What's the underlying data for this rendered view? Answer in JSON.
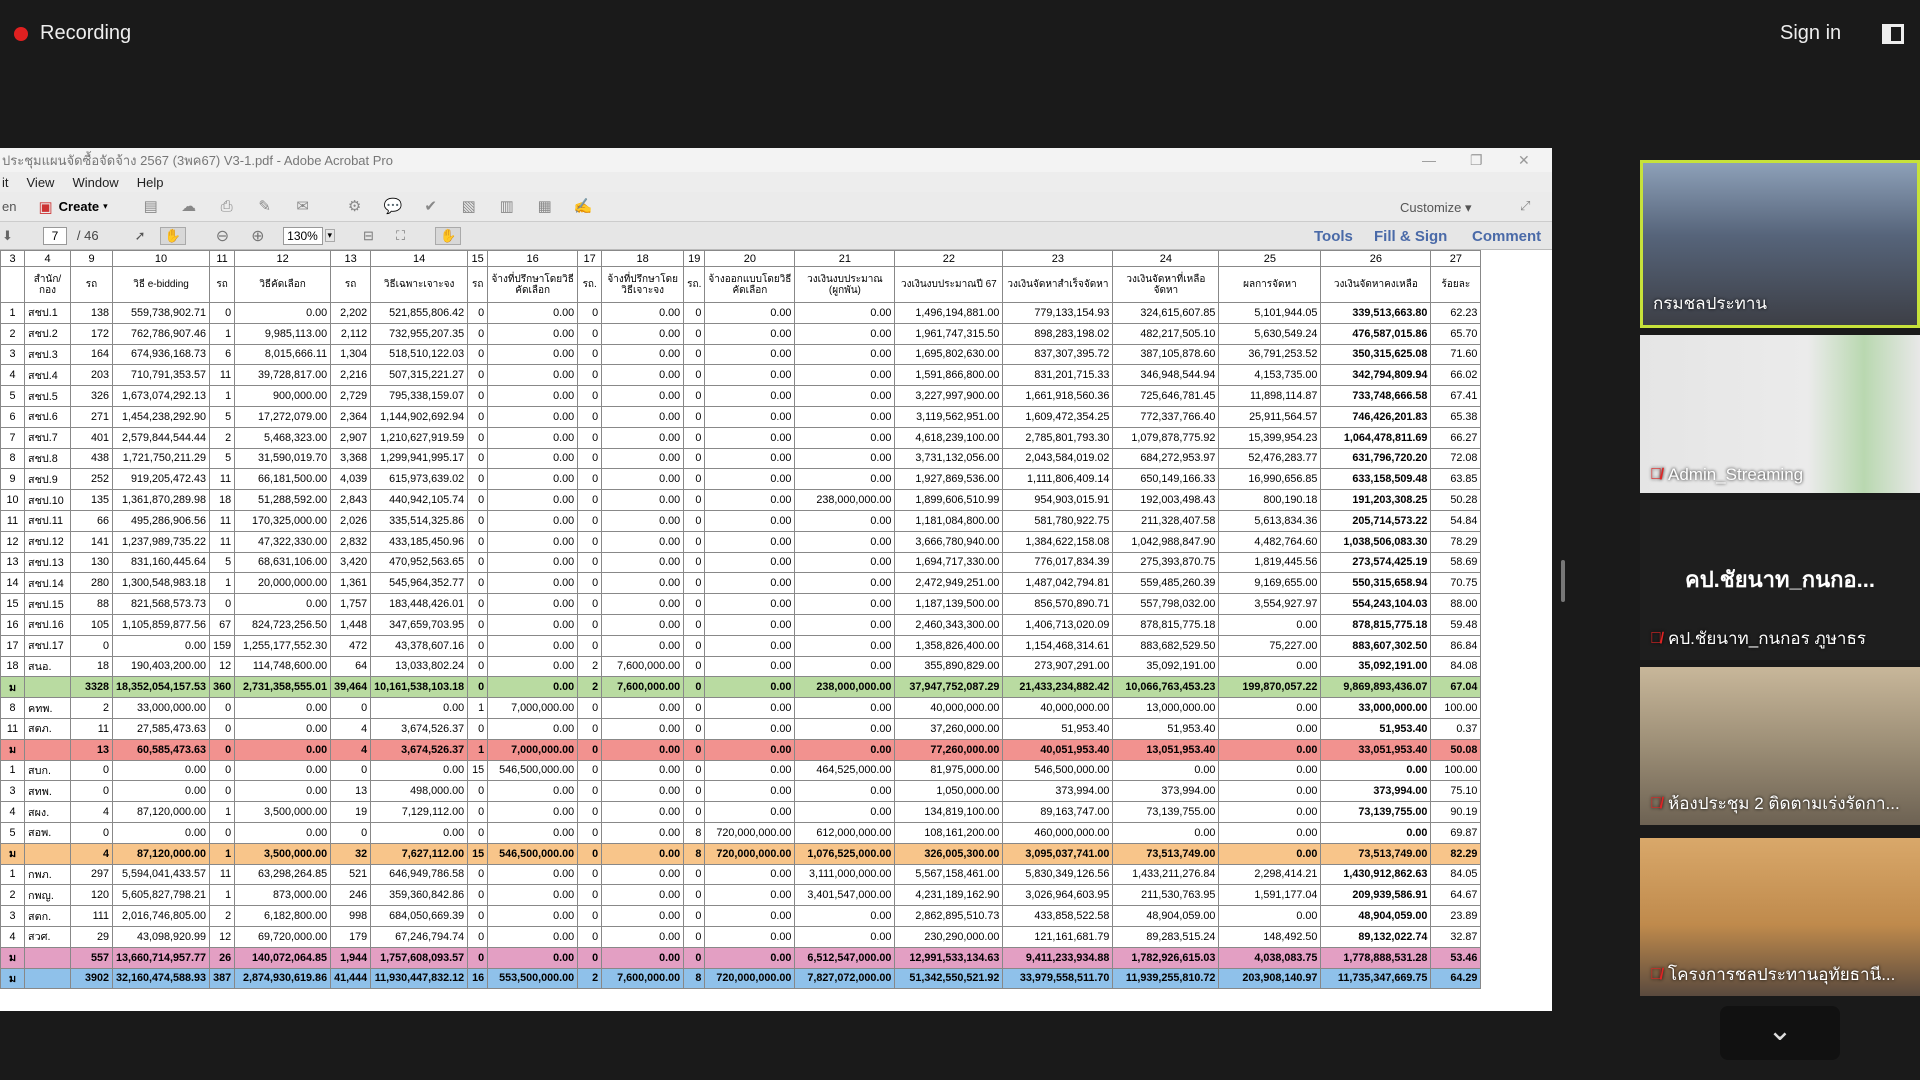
{
  "recording": {
    "label": "Recording"
  },
  "signin": "Sign in",
  "acrobat": {
    "title": "ประชุมแผนจัดซื้อจัดจ้าง 2567 (3พค67) V3-1.pdf - Adobe Acrobat Pro",
    "menus": [
      "it",
      "View",
      "Window",
      "Help"
    ],
    "create": "Create",
    "customize": "Customize",
    "page_current": "7",
    "page_total": "/ 46",
    "zoom": "130%",
    "tabs": [
      "Tools",
      "Fill & Sign",
      "Comment"
    ]
  },
  "table": {
    "colnums": [
      "3",
      "4",
      "9",
      "10",
      "11",
      "12",
      "13",
      "14",
      "15",
      "16",
      "17",
      "18",
      "19",
      "20",
      "21",
      "22",
      "23",
      "24",
      "25",
      "26",
      "27"
    ],
    "headers": [
      "",
      "สำนัก/กอง",
      "รถ",
      "วิธี e-bidding",
      "รถ",
      "วิธีคัดเลือก",
      "รถ",
      "วิธีเฉพาะเจาะจง",
      "รถ",
      "จ้างที่ปรึกษาโดยวิธีคัดเลือก",
      "รถ.",
      "จ้างที่ปรึกษาโดยวิธีเจาะจง",
      "รถ.",
      "จ้างออกแบบโดยวิธีคัดเลือก",
      "วงเงินงบประมาณ (ผูกพัน)",
      "วงเงินงบประมาณปี 67",
      "วงเงินจัดหาสำเร็จจัดหา",
      "วงเงินจัดหาที่เหลือจัดหา",
      "ผลการจัดหา",
      "วงเงินจัดหาคงเหลือ",
      "ร้อยละ"
    ],
    "rows": [
      {
        "c": [
          "1",
          "สชป.1",
          "138",
          "559,738,902.71",
          "0",
          "0.00",
          "2,202",
          "521,855,806.42",
          "0",
          "0.00",
          "0",
          "0.00",
          "0",
          "0.00",
          "0.00",
          "1,496,194,881.00",
          "779,133,154.93",
          "324,615,607.85",
          "5,101,944.05",
          "339,513,663.80",
          "62.23"
        ],
        "s": ""
      },
      {
        "c": [
          "2",
          "สชป.2",
          "172",
          "762,786,907.46",
          "1",
          "9,985,113.00",
          "2,112",
          "732,955,207.35",
          "0",
          "0.00",
          "0",
          "0.00",
          "0",
          "0.00",
          "0.00",
          "1,961,747,315.50",
          "898,283,198.02",
          "482,217,505.10",
          "5,630,549.24",
          "476,587,015.86",
          "65.70"
        ],
        "s": ""
      },
      {
        "c": [
          "3",
          "สชป.3",
          "164",
          "674,936,168.73",
          "6",
          "8,015,666.11",
          "1,304",
          "518,510,122.03",
          "0",
          "0.00",
          "0",
          "0.00",
          "0",
          "0.00",
          "0.00",
          "1,695,802,630.00",
          "837,307,395.72",
          "387,105,878.60",
          "36,791,253.52",
          "350,315,625.08",
          "71.60"
        ],
        "s": ""
      },
      {
        "c": [
          "4",
          "สชป.4",
          "203",
          "710,791,353.57",
          "11",
          "39,728,817.00",
          "2,216",
          "507,315,221.27",
          "0",
          "0.00",
          "0",
          "0.00",
          "0",
          "0.00",
          "0.00",
          "1,591,866,800.00",
          "831,201,715.33",
          "346,948,544.94",
          "4,153,735.00",
          "342,794,809.94",
          "66.02"
        ],
        "s": ""
      },
      {
        "c": [
          "5",
          "สชป.5",
          "326",
          "1,673,074,292.13",
          "1",
          "900,000.00",
          "2,729",
          "795,338,159.07",
          "0",
          "0.00",
          "0",
          "0.00",
          "0",
          "0.00",
          "0.00",
          "3,227,997,900.00",
          "1,661,918,560.36",
          "725,646,781.45",
          "11,898,114.87",
          "733,748,666.58",
          "67.41"
        ],
        "s": ""
      },
      {
        "c": [
          "6",
          "สชป.6",
          "271",
          "1,454,238,292.90",
          "5",
          "17,272,079.00",
          "2,364",
          "1,144,902,692.94",
          "0",
          "0.00",
          "0",
          "0.00",
          "0",
          "0.00",
          "0.00",
          "3,119,562,951.00",
          "1,609,472,354.25",
          "772,337,766.40",
          "25,911,564.57",
          "746,426,201.83",
          "65.38"
        ],
        "s": ""
      },
      {
        "c": [
          "7",
          "สชป.7",
          "401",
          "2,579,844,544.44",
          "2",
          "5,468,323.00",
          "2,907",
          "1,210,627,919.59",
          "0",
          "0.00",
          "0",
          "0.00",
          "0",
          "0.00",
          "0.00",
          "4,618,239,100.00",
          "2,785,801,793.30",
          "1,079,878,775.92",
          "15,399,954.23",
          "1,064,478,811.69",
          "66.27"
        ],
        "s": ""
      },
      {
        "c": [
          "8",
          "สชป.8",
          "438",
          "1,721,750,211.29",
          "5",
          "31,590,019.70",
          "3,368",
          "1,299,941,995.17",
          "0",
          "0.00",
          "0",
          "0.00",
          "0",
          "0.00",
          "0.00",
          "3,731,132,056.00",
          "2,043,584,019.02",
          "684,272,953.97",
          "52,476,283.77",
          "631,796,720.20",
          "72.08"
        ],
        "s": ""
      },
      {
        "c": [
          "9",
          "สชป.9",
          "252",
          "919,205,472.43",
          "11",
          "66,181,500.00",
          "4,039",
          "615,973,639.02",
          "0",
          "0.00",
          "0",
          "0.00",
          "0",
          "0.00",
          "0.00",
          "1,927,869,536.00",
          "1,111,806,409.14",
          "650,149,166.33",
          "16,990,656.85",
          "633,158,509.48",
          "63.85"
        ],
        "s": ""
      },
      {
        "c": [
          "10",
          "สชป.10",
          "135",
          "1,361,870,289.98",
          "18",
          "51,288,592.00",
          "2,843",
          "440,942,105.74",
          "0",
          "0.00",
          "0",
          "0.00",
          "0",
          "0.00",
          "238,000,000.00",
          "1,899,606,510.99",
          "954,903,015.91",
          "192,003,498.43",
          "800,190.18",
          "191,203,308.25",
          "50.28"
        ],
        "s": ""
      },
      {
        "c": [
          "11",
          "สชป.11",
          "66",
          "495,286,906.56",
          "11",
          "170,325,000.00",
          "2,026",
          "335,514,325.86",
          "0",
          "0.00",
          "0",
          "0.00",
          "0",
          "0.00",
          "0.00",
          "1,181,084,800.00",
          "581,780,922.75",
          "211,328,407.58",
          "5,613,834.36",
          "205,714,573.22",
          "54.84"
        ],
        "s": ""
      },
      {
        "c": [
          "12",
          "สชป.12",
          "141",
          "1,237,989,735.22",
          "11",
          "47,322,330.00",
          "2,832",
          "433,185,450.96",
          "0",
          "0.00",
          "0",
          "0.00",
          "0",
          "0.00",
          "0.00",
          "3,666,780,940.00",
          "1,384,622,158.08",
          "1,042,988,847.90",
          "4,482,764.60",
          "1,038,506,083.30",
          "78.29"
        ],
        "s": ""
      },
      {
        "c": [
          "13",
          "สชป.13",
          "130",
          "831,160,445.64",
          "5",
          "68,631,106.00",
          "3,420",
          "470,952,563.65",
          "0",
          "0.00",
          "0",
          "0.00",
          "0",
          "0.00",
          "0.00",
          "1,694,717,330.00",
          "776,017,834.39",
          "275,393,870.75",
          "1,819,445.56",
          "273,574,425.19",
          "58.69"
        ],
        "s": ""
      },
      {
        "c": [
          "14",
          "สชป.14",
          "280",
          "1,300,548,983.18",
          "1",
          "20,000,000.00",
          "1,361",
          "545,964,352.77",
          "0",
          "0.00",
          "0",
          "0.00",
          "0",
          "0.00",
          "0.00",
          "2,472,949,251.00",
          "1,487,042,794.81",
          "559,485,260.39",
          "9,169,655.00",
          "550,315,658.94",
          "70.75"
        ],
        "s": ""
      },
      {
        "c": [
          "15",
          "สชป.15",
          "88",
          "821,568,573.73",
          "0",
          "0.00",
          "1,757",
          "183,448,426.01",
          "0",
          "0.00",
          "0",
          "0.00",
          "0",
          "0.00",
          "0.00",
          "1,187,139,500.00",
          "856,570,890.71",
          "557,798,032.00",
          "3,554,927.97",
          "554,243,104.03",
          "88.00"
        ],
        "s": ""
      },
      {
        "c": [
          "16",
          "สชป.16",
          "105",
          "1,105,859,877.56",
          "67",
          "824,723,256.50",
          "1,448",
          "347,659,703.95",
          "0",
          "0.00",
          "0",
          "0.00",
          "0",
          "0.00",
          "0.00",
          "2,460,343,300.00",
          "1,406,713,020.09",
          "878,815,775.18",
          "0.00",
          "878,815,775.18",
          "59.48"
        ],
        "s": ""
      },
      {
        "c": [
          "17",
          "สชป.17",
          "0",
          "0.00",
          "159",
          "1,255,177,552.30",
          "472",
          "43,378,607.16",
          "0",
          "0.00",
          "0",
          "0.00",
          "0",
          "0.00",
          "0.00",
          "1,358,826,400.00",
          "1,154,468,314.61",
          "883,682,529.50",
          "75,227.00",
          "883,607,302.50",
          "86.84"
        ],
        "s": ""
      },
      {
        "c": [
          "18",
          "สนอ.",
          "18",
          "190,403,200.00",
          "12",
          "114,748,600.00",
          "64",
          "13,033,802.24",
          "0",
          "0.00",
          "2",
          "7,600,000.00",
          "0",
          "0.00",
          "0.00",
          "355,890,829.00",
          "273,907,291.00",
          "35,092,191.00",
          "0.00",
          "35,092,191.00",
          "84.08"
        ],
        "s": ""
      },
      {
        "c": [
          "ม",
          "",
          "3328",
          "18,352,054,157.53",
          "360",
          "2,731,358,555.01",
          "39,464",
          "10,161,538,103.18",
          "0",
          "0.00",
          "2",
          "7,600,000.00",
          "0",
          "0.00",
          "238,000,000.00",
          "37,947,752,087.29",
          "21,433,234,882.42",
          "10,066,763,453.23",
          "199,870,057.22",
          "9,869,893,436.07",
          "67.04"
        ],
        "s": "tot-green"
      },
      {
        "c": [
          "8",
          "คทพ.",
          "2",
          "33,000,000.00",
          "0",
          "0.00",
          "0",
          "0.00",
          "1",
          "7,000,000.00",
          "0",
          "0.00",
          "0",
          "0.00",
          "0.00",
          "40,000,000.00",
          "40,000,000.00",
          "13,000,000.00",
          "0.00",
          "33,000,000.00",
          "100.00"
        ],
        "s": ""
      },
      {
        "c": [
          "11",
          "สตภ.",
          "11",
          "27,585,473.63",
          "0",
          "0.00",
          "4",
          "3,674,526.37",
          "0",
          "0.00",
          "0",
          "0.00",
          "0",
          "0.00",
          "0.00",
          "37,260,000.00",
          "51,953.40",
          "51,953.40",
          "0.00",
          "51,953.40",
          "0.37"
        ],
        "s": ""
      },
      {
        "c": [
          "ม",
          "",
          "13",
          "60,585,473.63",
          "0",
          "0.00",
          "4",
          "3,674,526.37",
          "1",
          "7,000,000.00",
          "0",
          "0.00",
          "0",
          "0.00",
          "0.00",
          "77,260,000.00",
          "40,051,953.40",
          "13,051,953.40",
          "0.00",
          "33,051,953.40",
          "50.08"
        ],
        "s": "tot-red"
      },
      {
        "c": [
          "1",
          "สบก.",
          "0",
          "0.00",
          "0",
          "0.00",
          "0",
          "0.00",
          "15",
          "546,500,000.00",
          "0",
          "0.00",
          "0",
          "0.00",
          "464,525,000.00",
          "81,975,000.00",
          "546,500,000.00",
          "0.00",
          "0.00",
          "0.00",
          "100.00"
        ],
        "s": ""
      },
      {
        "c": [
          "3",
          "สทพ.",
          "0",
          "0.00",
          "0",
          "0.00",
          "13",
          "498,000.00",
          "0",
          "0.00",
          "0",
          "0.00",
          "0",
          "0.00",
          "0.00",
          "1,050,000.00",
          "373,994.00",
          "373,994.00",
          "0.00",
          "373,994.00",
          "75.10"
        ],
        "s": ""
      },
      {
        "c": [
          "4",
          "สผง.",
          "4",
          "87,120,000.00",
          "1",
          "3,500,000.00",
          "19",
          "7,129,112.00",
          "0",
          "0.00",
          "0",
          "0.00",
          "0",
          "0.00",
          "0.00",
          "134,819,100.00",
          "89,163,747.00",
          "73,139,755.00",
          "0.00",
          "73,139,755.00",
          "90.19"
        ],
        "s": ""
      },
      {
        "c": [
          "5",
          "สอพ.",
          "0",
          "0.00",
          "0",
          "0.00",
          "0",
          "0.00",
          "0",
          "0.00",
          "0",
          "0.00",
          "8",
          "720,000,000.00",
          "612,000,000.00",
          "108,161,200.00",
          "460,000,000.00",
          "0.00",
          "0.00",
          "0.00",
          "69.87"
        ],
        "s": ""
      },
      {
        "c": [
          "ม",
          "",
          "4",
          "87,120,000.00",
          "1",
          "3,500,000.00",
          "32",
          "7,627,112.00",
          "15",
          "546,500,000.00",
          "0",
          "0.00",
          "8",
          "720,000,000.00",
          "1,076,525,000.00",
          "326,005,300.00",
          "3,095,037,741.00",
          "73,513,749.00",
          "0.00",
          "73,513,749.00",
          "82.29"
        ],
        "s": "tot-orange"
      },
      {
        "c": [
          "1",
          "กพภ.",
          "297",
          "5,594,041,433.57",
          "11",
          "63,298,264.85",
          "521",
          "646,949,786.58",
          "0",
          "0.00",
          "0",
          "0.00",
          "0",
          "0.00",
          "3,111,000,000.00",
          "5,567,158,461.00",
          "5,830,349,126.56",
          "1,433,211,276.84",
          "2,298,414.21",
          "1,430,912,862.63",
          "84.05"
        ],
        "s": ""
      },
      {
        "c": [
          "2",
          "กพญ.",
          "120",
          "5,605,827,798.21",
          "1",
          "873,000.00",
          "246",
          "359,360,842.86",
          "0",
          "0.00",
          "0",
          "0.00",
          "0",
          "0.00",
          "3,401,547,000.00",
          "4,231,189,162.90",
          "3,026,964,603.95",
          "211,530,763.95",
          "1,591,177.04",
          "209,939,586.91",
          "64.67"
        ],
        "s": ""
      },
      {
        "c": [
          "3",
          "สตก.",
          "111",
          "2,016,746,805.00",
          "2",
          "6,182,800.00",
          "998",
          "684,050,669.39",
          "0",
          "0.00",
          "0",
          "0.00",
          "0",
          "0.00",
          "0.00",
          "2,862,895,510.73",
          "433,858,522.58",
          "48,904,059.00",
          "0.00",
          "48,904,059.00",
          "23.89"
        ],
        "s": ""
      },
      {
        "c": [
          "4",
          "สวศ.",
          "29",
          "43,098,920.99",
          "12",
          "69,720,000.00",
          "179",
          "67,246,794.74",
          "0",
          "0.00",
          "0",
          "0.00",
          "0",
          "0.00",
          "0.00",
          "230,290,000.00",
          "121,161,681.79",
          "89,283,515.24",
          "148,492.50",
          "89,132,022.74",
          "32.87"
        ],
        "s": ""
      },
      {
        "c": [
          "ม",
          "",
          "557",
          "13,660,714,957.77",
          "26",
          "140,072,064.85",
          "1,944",
          "1,757,608,093.57",
          "0",
          "0.00",
          "0",
          "0.00",
          "0",
          "0.00",
          "6,512,547,000.00",
          "12,991,533,134.63",
          "9,411,233,934.88",
          "1,782,926,615.03",
          "4,038,083.75",
          "1,778,888,531.28",
          "53.46"
        ],
        "s": "tot-pink"
      },
      {
        "c": [
          "ม",
          "",
          "3902",
          "32,160,474,588.93",
          "387",
          "2,874,930,619.86",
          "41,444",
          "11,930,447,832.12",
          "16",
          "553,500,000.00",
          "2",
          "7,600,000.00",
          "8",
          "720,000,000.00",
          "7,827,072,000.00",
          "51,342,550,521.92",
          "33,979,558,511.70",
          "11,939,255,810.72",
          "203,908,140.97",
          "11,735,347,669.75",
          "64.29"
        ],
        "s": "tot-blue"
      }
    ]
  },
  "participants": [
    {
      "name": "กรมชลประทาน",
      "muted": false
    },
    {
      "name": "Admin_Streaming",
      "muted": true
    },
    {
      "name": "คป.ชัยนาท_กนกอร ภูษาธร",
      "big": "คป.ชัยนาท_กนกอ...",
      "muted": true
    },
    {
      "name": "ห้องประชุม 2 ติดตามเร่งรัดกา...",
      "muted": true
    },
    {
      "name": "โครงการชลประทานอุทัยธานี...",
      "muted": true
    }
  ]
}
